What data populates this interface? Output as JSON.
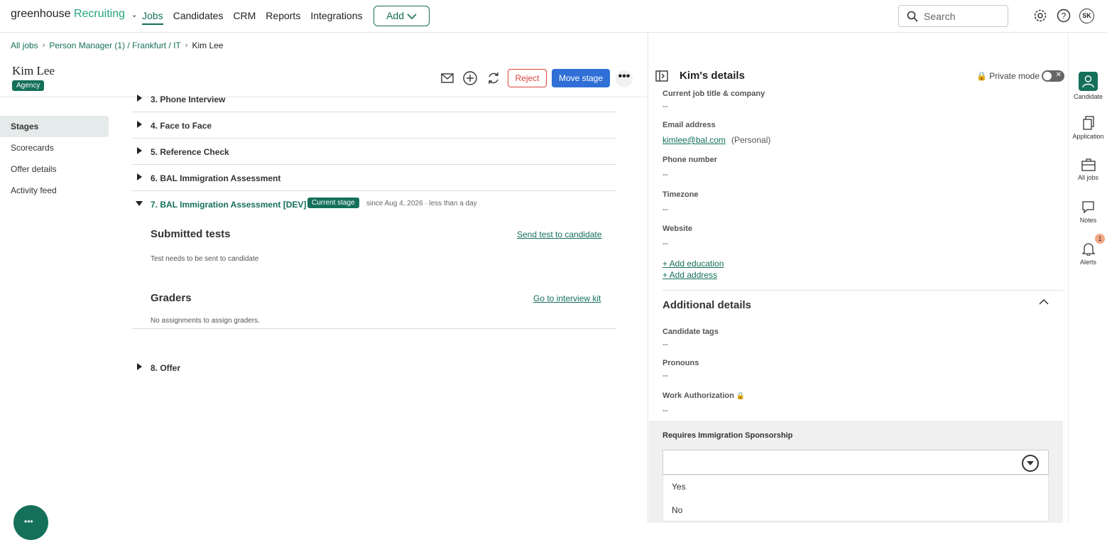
{
  "nav": {
    "logo_main": "greenhouse",
    "logo_sub": "Recruiting",
    "links": [
      "Jobs",
      "Candidates",
      "CRM",
      "Reports",
      "Integrations"
    ],
    "add_label": "Add",
    "search_placeholder": "Search",
    "avatar_initials": "SK"
  },
  "breadcrumb": {
    "all_jobs": "All jobs",
    "job": "Person Manager (1) / Frankfurt / IT",
    "current": "Kim Lee"
  },
  "candidate": {
    "name": "Kim Lee",
    "badge": "Agency"
  },
  "actions": {
    "reject": "Reject",
    "move_stage": "Move stage",
    "more": "•••"
  },
  "left_nav": [
    "Stages",
    "Scorecards",
    "Offer details",
    "Activity feed"
  ],
  "stages": [
    {
      "label": "3. Phone Interview"
    },
    {
      "label": "4. Face to Face"
    },
    {
      "label": "5. Reference Check"
    },
    {
      "label": "6. BAL Immigration Assessment"
    },
    {
      "label": "7. BAL Immigration Assessment [DEV]",
      "badge": "Current stage",
      "since": "since Aug 4, 2026  ·  less than a day"
    },
    {
      "label": "8. Offer"
    }
  ],
  "current_stage": {
    "tests_title": "Submitted tests",
    "tests_link": "Send test to candidate",
    "tests_note": "Test needs to be sent to candidate",
    "graders_title": "Graders",
    "graders_link": "Go to interview kit",
    "graders_note": "No assignments to assign graders."
  },
  "details": {
    "title": "Kim's details",
    "private_mode": "Private mode",
    "fields": {
      "job_title_label": "Current job title & company",
      "job_title_value": "--",
      "email_label": "Email address",
      "email_value": "kimlee@bal.com",
      "email_type": "(Personal)",
      "phone_label": "Phone number",
      "phone_value": "--",
      "timezone_label": "Timezone",
      "timezone_value": "--",
      "website_label": "Website",
      "website_value": "--",
      "add_education": "+ Add education",
      "add_address": "+ Add address"
    },
    "additional": {
      "title": "Additional details",
      "tags_label": "Candidate tags",
      "tags_value": "--",
      "pronouns_label": "Pronouns",
      "pronouns_value": "--",
      "work_auth_label": "Work Authorization",
      "work_auth_value": "--",
      "sponsorship_label": "Requires Immigration Sponsorship",
      "sponsorship_value": "",
      "options": [
        "Yes",
        "No"
      ]
    }
  },
  "right_bar": {
    "items": [
      "Candidate",
      "Application",
      "All jobs",
      "Notes",
      "Alerts"
    ],
    "alerts_count": "1"
  },
  "colors": {
    "brand": "#15705a",
    "primary": "#2f6fd6",
    "danger": "#d9453d"
  }
}
